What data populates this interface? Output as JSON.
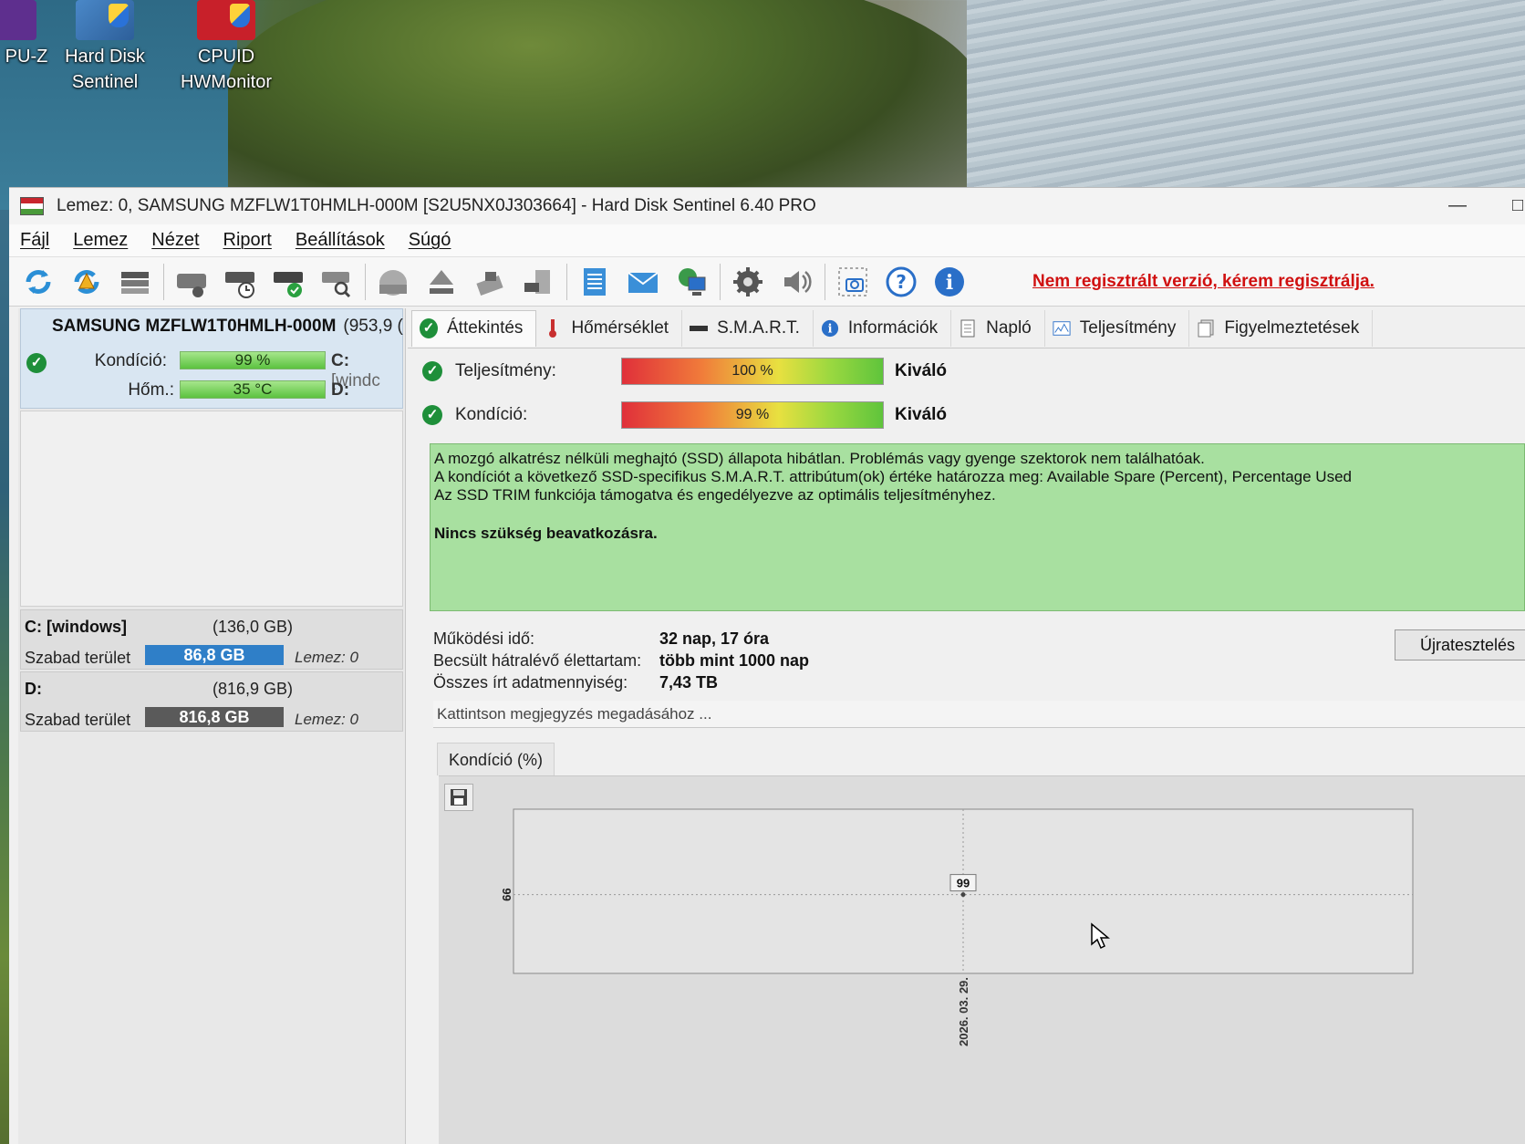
{
  "desktop": {
    "icons": [
      {
        "label_line1": "PU-Z",
        "label_line2": ""
      },
      {
        "label_line1": "Hard Disk",
        "label_line2": "Sentinel"
      },
      {
        "label_line1": "CPUID",
        "label_line2": "HWMonitor"
      }
    ]
  },
  "window": {
    "title": "Lemez: 0, SAMSUNG MZFLW1T0HMLH-000M [S2U5NX0J303664]  -  Hard Disk Sentinel 6.40 PRO"
  },
  "menu": [
    "Fájl",
    "Lemez",
    "Nézet",
    "Riport",
    "Beállítások",
    "Súgó"
  ],
  "toolbar": {
    "register_link": "Nem regisztrált verzió, kérem regisztrálja."
  },
  "disk": {
    "name": "SAMSUNG MZFLW1T0HMLH-000M",
    "size": "(953,9 (",
    "condition_label": "Kondíció:",
    "condition_value": "99 %",
    "temp_label": "Hőm.:",
    "temp_value": "35 °C",
    "drive_c": "C:",
    "drive_c_suffix": "[windc",
    "drive_d": "D:"
  },
  "volumes": [
    {
      "name": "C: [windows]",
      "size": "(136,0 GB)",
      "free_label": "Szabad terület",
      "free_value": "86,8 GB",
      "disk_label": "Lemez: 0",
      "bar_color": "#2f7fc8"
    },
    {
      "name": "D:",
      "size": "(816,9 GB)",
      "free_label": "Szabad terület",
      "free_value": "816,8 GB",
      "disk_label": "Lemez: 0",
      "bar_color": "#5a5a5a"
    }
  ],
  "tabs": [
    "Áttekintés",
    "Hőmérséklet",
    "S.M.A.R.T.",
    "Információk",
    "Napló",
    "Teljesítmény",
    "Figyelmeztetések"
  ],
  "overview": {
    "performance_label": "Teljesítmény:",
    "performance_value": "100 %",
    "performance_rating": "Kiváló",
    "condition_label": "Kondíció:",
    "condition_value": "99 %",
    "condition_rating": "Kiváló",
    "status_lines": [
      "A mozgó alkatrész nélküli meghajtó (SSD) állapota hibátlan. Problémás vagy gyenge szektorok nem találhatóak.",
      "A kondíciót a következő SSD-specifikus S.M.A.R.T. attribútum(ok) értéke határozza meg:  Available Spare (Percent), Percentage Used",
      "Az SSD TRIM funkciója támogatva és engedélyezve az optimális teljesítményhez."
    ],
    "status_action": "Nincs szükség beavatkozásra.",
    "uptime_label": "Működési idő:",
    "uptime_value": "32 nap, 17 óra",
    "lifetime_label": "Becsült hátralévő élettartam:",
    "lifetime_value": "több mint 1000 nap",
    "written_label": "Összes írt adatmennyiség:",
    "written_value": "7,43 TB",
    "retest_button": "Újratesztelés",
    "note_placeholder": "Kattintson megjegyzés megadásához ...",
    "chart_tab": "Kondíció  (%)"
  },
  "chart_data": {
    "type": "line",
    "x": [
      "2026. 03. 29."
    ],
    "values": [
      99
    ],
    "y_ticks": [
      "99"
    ],
    "point_labels": [
      "99"
    ]
  }
}
